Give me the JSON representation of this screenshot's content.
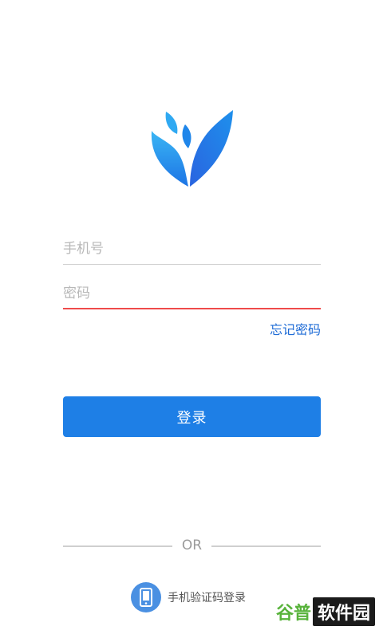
{
  "login": {
    "phone_placeholder": "手机号",
    "password_placeholder": "密码",
    "forgot_label": "忘记密码",
    "login_label": "登录",
    "or_text": "OR",
    "sms_login_label": "手机验证码登录"
  },
  "icons": {
    "logo": "leaf-logo-icon",
    "sms": "mobile-phone-icon"
  },
  "colors": {
    "primary": "#1e7fe6",
    "link": "#1e6bd6",
    "active_underline": "#ef4b4b",
    "logo_light": "#37b4f3",
    "logo_dark": "#1e76e6"
  },
  "watermark": {
    "part1": "谷普",
    "part2": "软件园"
  }
}
